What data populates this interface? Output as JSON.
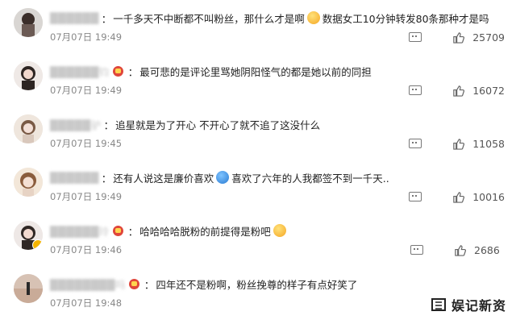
{
  "comments": [
    {
      "name": "██████",
      "text": "一千多天不中断都不叫粉丝，那什么才是啊",
      "text2": "数据女工10分钟转发80条那种才是吗",
      "time": "07月07日 19:49",
      "likes": "25709",
      "has_badge": false,
      "emoji": "emoji-shocked"
    },
    {
      "name": "██████钧",
      "text": "最可悲的是评论里骂她阴阳怪气的都是她以前的同担",
      "time": "07月07日 19:49",
      "likes": "16072",
      "has_badge": true
    },
    {
      "name": "█████驴",
      "text": "追星就是为了开心 不开心了就不追了这没什么",
      "time": "07月07日 19:45",
      "likes": "11058",
      "has_badge": false
    },
    {
      "name": "██████",
      "text": "还有人说这是廉价喜欢",
      "text2": "喜欢了六年的人我都签不到一千天..",
      "time": "07月07日 19:49",
      "likes": "10016",
      "has_badge": false,
      "emoji": "emoji-doraemon"
    },
    {
      "name": "██████玲",
      "text": "哈哈哈哈脱粉的前提得是粉吧",
      "time": "07月07日 19:46",
      "likes": "2686",
      "has_badge": true,
      "emoji": "emoji-kiss"
    },
    {
      "name": "████████吗",
      "text": "四年还不是粉啊，粉丝挽尊的样子有点好笑了",
      "time": "07月07日 19:48",
      "likes": "",
      "has_badge": true
    }
  ],
  "watermark": {
    "text": "娱记新资"
  }
}
